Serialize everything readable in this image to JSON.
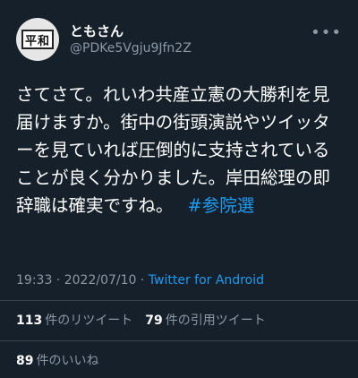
{
  "user": {
    "display_name": "ともさん",
    "handle": "@PDKe5Vgju9Jfn2Z",
    "avatar_text": "平和"
  },
  "tweet": {
    "text": "さてさて。れいわ共産立憲の大勝利を見届けますか。街中の街頭演説やツイッターを見ていれば圧倒的に支持されていることが良く分かりました。岸田総理の即辞職は確実ですね。",
    "hashtag": "#参院選"
  },
  "meta": {
    "time": "19:33",
    "sep1": "·",
    "date": "2022/07/10",
    "sep2": "·",
    "source": "Twitter for Android"
  },
  "stats": {
    "retweets_count": "113",
    "retweets_label": "件のリツイート",
    "quotes_count": "79",
    "quotes_label": "件の引用ツイート",
    "likes_count": "89",
    "likes_label": "件のいいね"
  },
  "icons": {
    "more": "more-icon"
  },
  "colors": {
    "background": "#15202b",
    "link": "#1d9bf0",
    "secondary_text": "#8b98a5",
    "divider": "#38444d"
  }
}
